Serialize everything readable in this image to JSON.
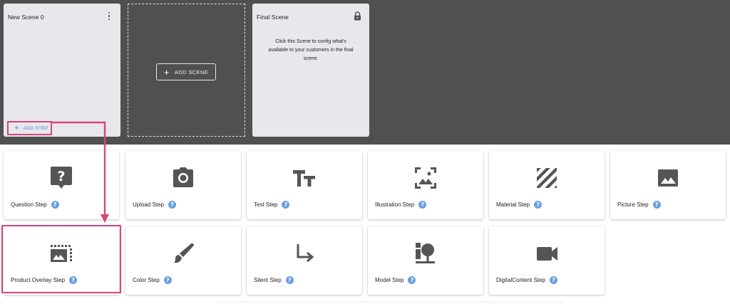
{
  "scenes": {
    "new_scene": {
      "title": "New Scene 0",
      "add_step_label": "ADD STEP"
    },
    "add_scene_label": "ADD SCENE",
    "final_scene": {
      "title": "Final Scene",
      "description": "Click this Scene to config what's available to your customers in the final scene."
    }
  },
  "steps": [
    {
      "label": "Question Step",
      "icon": "question-mark-speech-bubble-icon"
    },
    {
      "label": "Upload Step",
      "icon": "camera-icon"
    },
    {
      "label": "Text Step",
      "icon": "text-format-icon"
    },
    {
      "label": "Illustration Step",
      "icon": "image-frame-icon"
    },
    {
      "label": "Material Step",
      "icon": "striped-texture-icon"
    },
    {
      "label": "Picture Step",
      "icon": "picture-icon"
    },
    {
      "label": "Product Overlay Step",
      "icon": "image-overlay-icon"
    },
    {
      "label": "Color Step",
      "icon": "paint-brush-icon"
    },
    {
      "label": "Silent Step",
      "icon": "arrow-down-right-icon"
    },
    {
      "label": "Model Step",
      "icon": "model-tree-icon"
    },
    {
      "label": "DigitalContent Step",
      "icon": "video-camera-icon"
    }
  ],
  "colors": {
    "highlight": "#d6457a",
    "accent": "#4a7fd1",
    "help": "#6b9fe0",
    "panel": "#505050"
  }
}
